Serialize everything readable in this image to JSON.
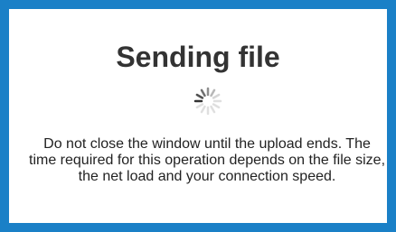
{
  "dialog": {
    "title": "Sending file",
    "spinner_icon": "loading-spinner-icon",
    "message": "Do not close the window until the upload ends. The time required for this operation depends on the file size, the net load and your connection speed."
  },
  "colors": {
    "border": "#1a80c7",
    "title": "#333333",
    "text": "#222222",
    "spinner": "#333333"
  }
}
